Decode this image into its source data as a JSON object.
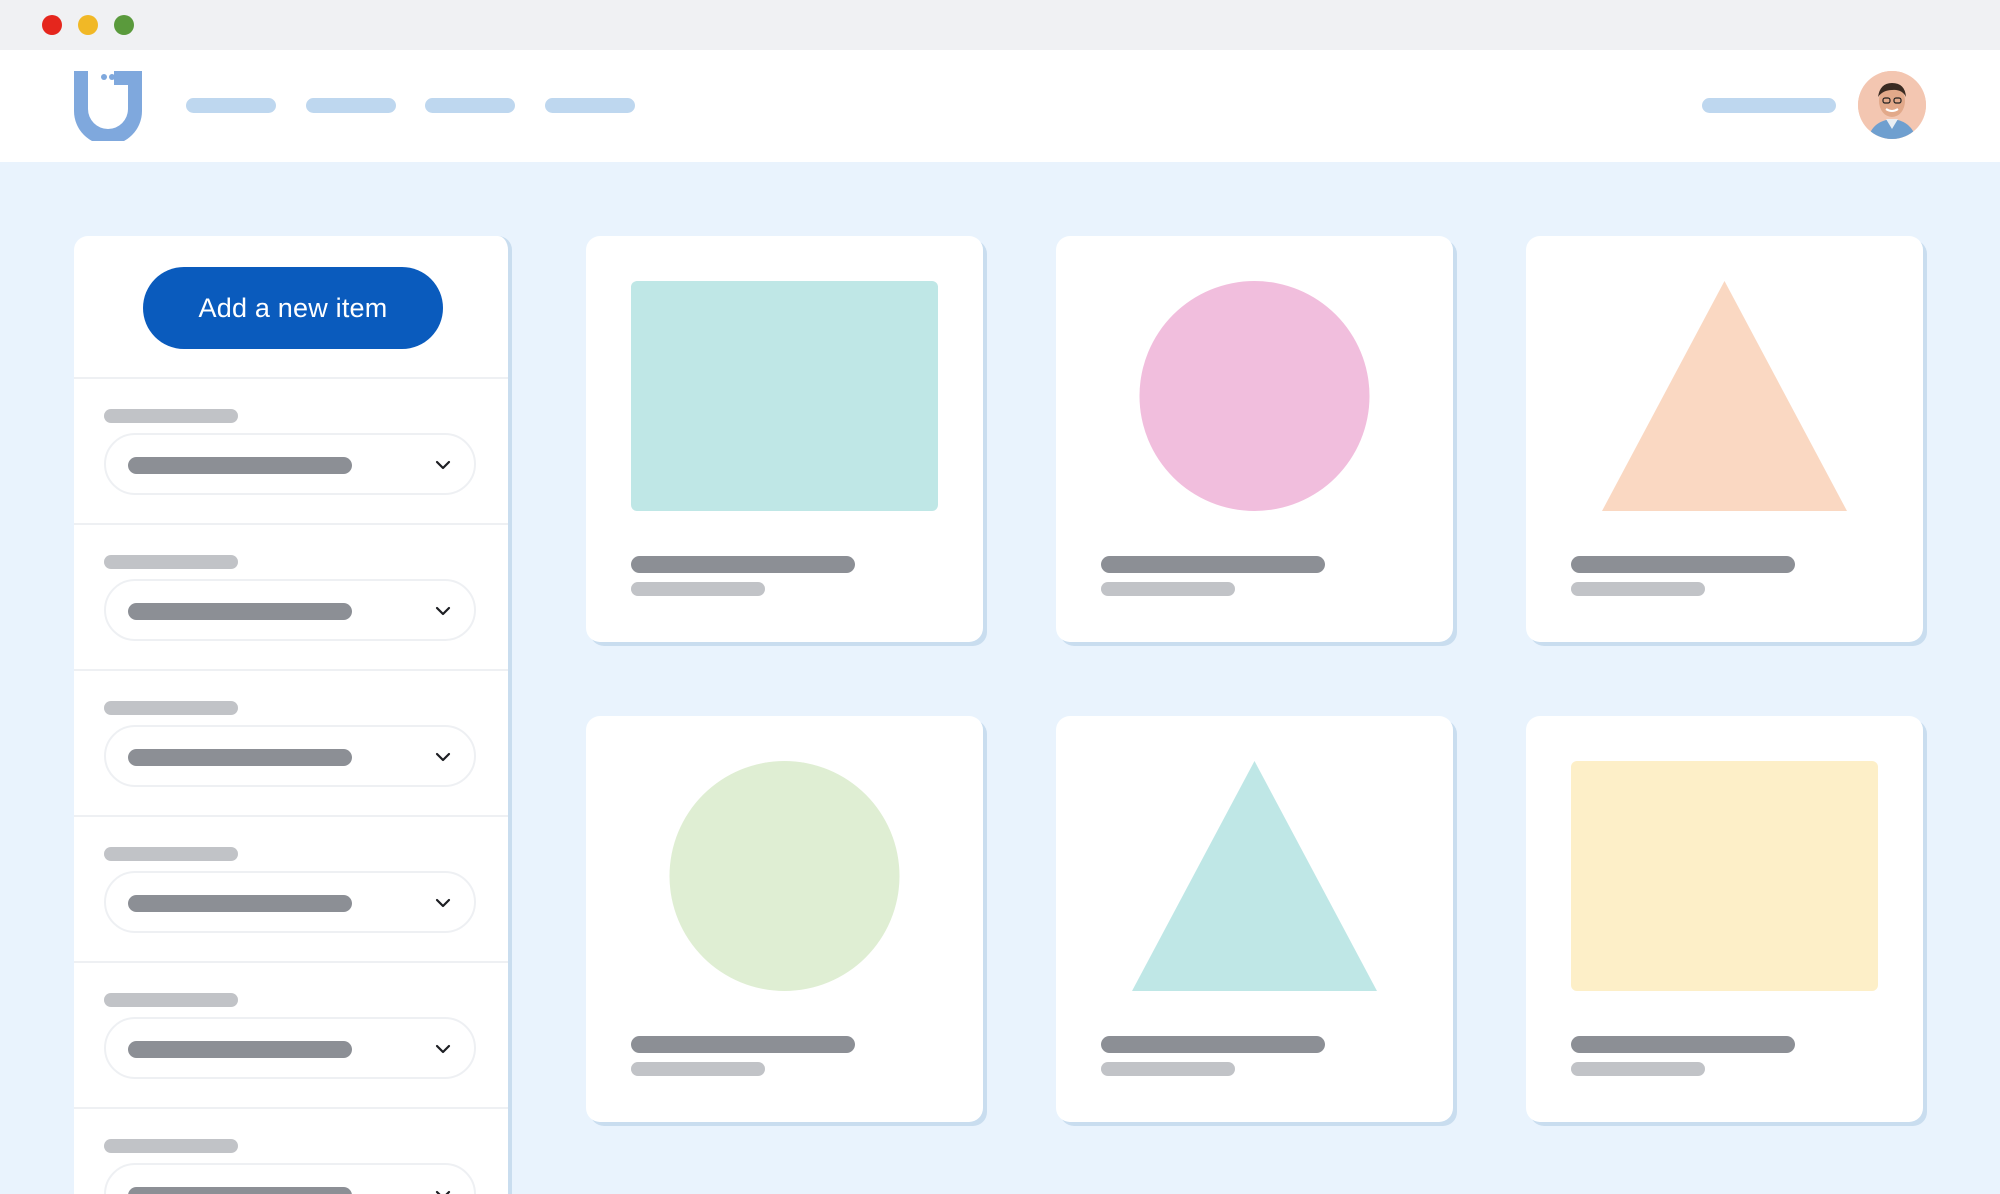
{
  "window": {
    "controls": [
      {
        "name": "close",
        "color": "#e5261d"
      },
      {
        "name": "minimize",
        "color": "#f1b826"
      },
      {
        "name": "maximize",
        "color": "#5a9a3c"
      }
    ]
  },
  "header": {
    "logo_icon": "hand-logo",
    "nav_links_count_visible": 4,
    "user_icon": "avatar-photo"
  },
  "sidebar": {
    "add_button_label": "Add a new item",
    "filters_visible": 6,
    "dropdown_icon": "chevron-down-icon"
  },
  "cards": [
    {
      "shape": "rectangle",
      "color": "#bfe7e6"
    },
    {
      "shape": "circle",
      "color": "#f1bedd"
    },
    {
      "shape": "triangle",
      "color": "#fad8c2"
    },
    {
      "shape": "circle",
      "color": "#dfeed3"
    },
    {
      "shape": "triangle",
      "color": "#bfe7e6"
    },
    {
      "shape": "rectangle",
      "color": "#fdefc8"
    }
  ],
  "colors": {
    "accent": "#0a5bbd",
    "background": "#e9f3fd",
    "placeholder_dark": "#8c8f95",
    "placeholder_light": "#c1c3c7",
    "nav_placeholder": "#bed7ef"
  }
}
